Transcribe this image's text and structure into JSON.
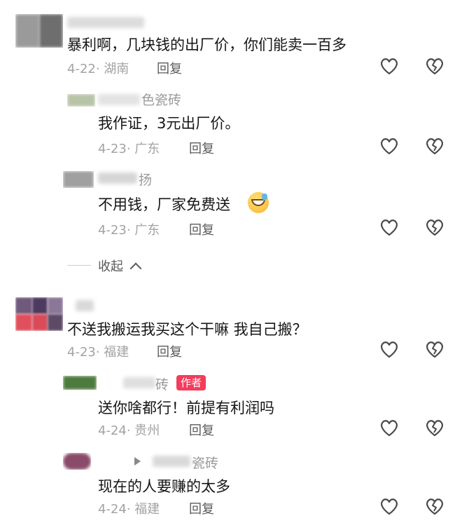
{
  "comments": [
    {
      "content": "暴利啊，几块钱的出厂价，你们能卖一百多",
      "meta": "4-22· 湖南",
      "reply_label": "回复",
      "replies": [
        {
          "name_visible": "色瓷砖",
          "content": "我作证，3元出厂价。",
          "meta": "4-23· 广东",
          "reply_label": "回复"
        },
        {
          "name_visible": "扬",
          "content": "不用钱，厂家免费送",
          "emoji": "grinning-sweat-emoji",
          "meta": "4-23· 广东",
          "reply_label": "回复"
        }
      ],
      "collapse_label": "收起"
    },
    {
      "content": "不送我搬运我买这个干嘛   我自己搬？",
      "meta": "4-23· 福建",
      "reply_label": "回复",
      "replies": [
        {
          "name_visible": "砖",
          "badge": "作者",
          "content": "送你啥都行！前提有利润吗",
          "meta": "4-24· 贵州",
          "reply_label": "回复"
        },
        {
          "name_visible": "瓷砖",
          "content": "现在的人要赚的太多",
          "meta": "4-24· 福建",
          "reply_label": "回复"
        }
      ]
    }
  ],
  "icons": {
    "like": "heart-outline-icon",
    "dislike": "broken-heart-icon",
    "collapse": "chevron-up-icon"
  },
  "colors": {
    "badge": "#f23d5c",
    "meta": "#a3a3a3",
    "text": "#161616"
  }
}
